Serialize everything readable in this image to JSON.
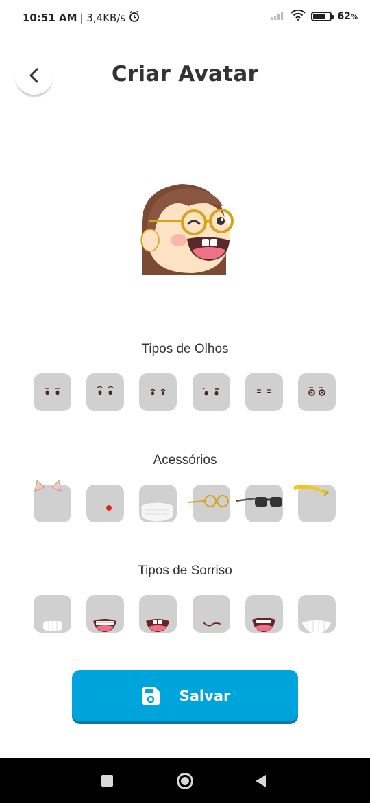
{
  "status_bar": {
    "time": "10:51 AM",
    "speed": "| 3,4KB/s",
    "battery": "62",
    "battery_unit": "%",
    "battery_level": 0.62,
    "icons": [
      "alarm-icon",
      "signal-icon",
      "wifi-icon",
      "battery-icon"
    ]
  },
  "header": {
    "title": "Criar Avatar",
    "back_icon": "chevron-left-icon"
  },
  "sections": {
    "eyes": {
      "title": "Tipos de Olhos",
      "options": [
        "eyes-round",
        "eyes-raised-brows",
        "eyes-squint",
        "eyes-lashes",
        "eyes-sleepy",
        "eyes-wide"
      ]
    },
    "accessories": {
      "title": "Acessórios",
      "options": [
        "cat-ears",
        "clown-nose",
        "face-mask",
        "round-glasses",
        "sunglasses",
        "headband"
      ]
    },
    "smiles": {
      "title": "Tipos de Sorriso",
      "options": [
        "big-teeth-smile",
        "braces-smile",
        "open-smile",
        "smirk",
        "laugh",
        "wide-teeth-grin"
      ]
    }
  },
  "save_button": {
    "label": "Salvar",
    "icon": "floppy-disk-icon"
  },
  "nav_bar": {
    "buttons": [
      "recents-square-icon",
      "home-circle-icon",
      "back-triangle-icon"
    ]
  },
  "colors": {
    "primary": "#00a4dc",
    "tile": "#d0d0d0",
    "hair": "#7a4a35",
    "skin": "#fde2c4",
    "glasses": "#d9a21b"
  }
}
